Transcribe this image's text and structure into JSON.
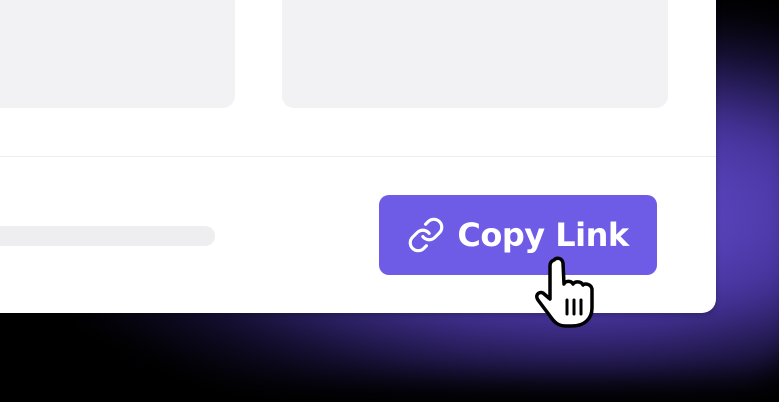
{
  "share_panel": {
    "copy_link_button": {
      "label": "Copy Link",
      "icon": "link-icon",
      "color": "#6e5ce6"
    },
    "cursor_icon": "pointer-hand-icon"
  },
  "colors": {
    "background": "#000000",
    "glow": "#7058e6",
    "card": "#ffffff",
    "tile": "#f2f2f4",
    "button": "#6e5ce6"
  }
}
